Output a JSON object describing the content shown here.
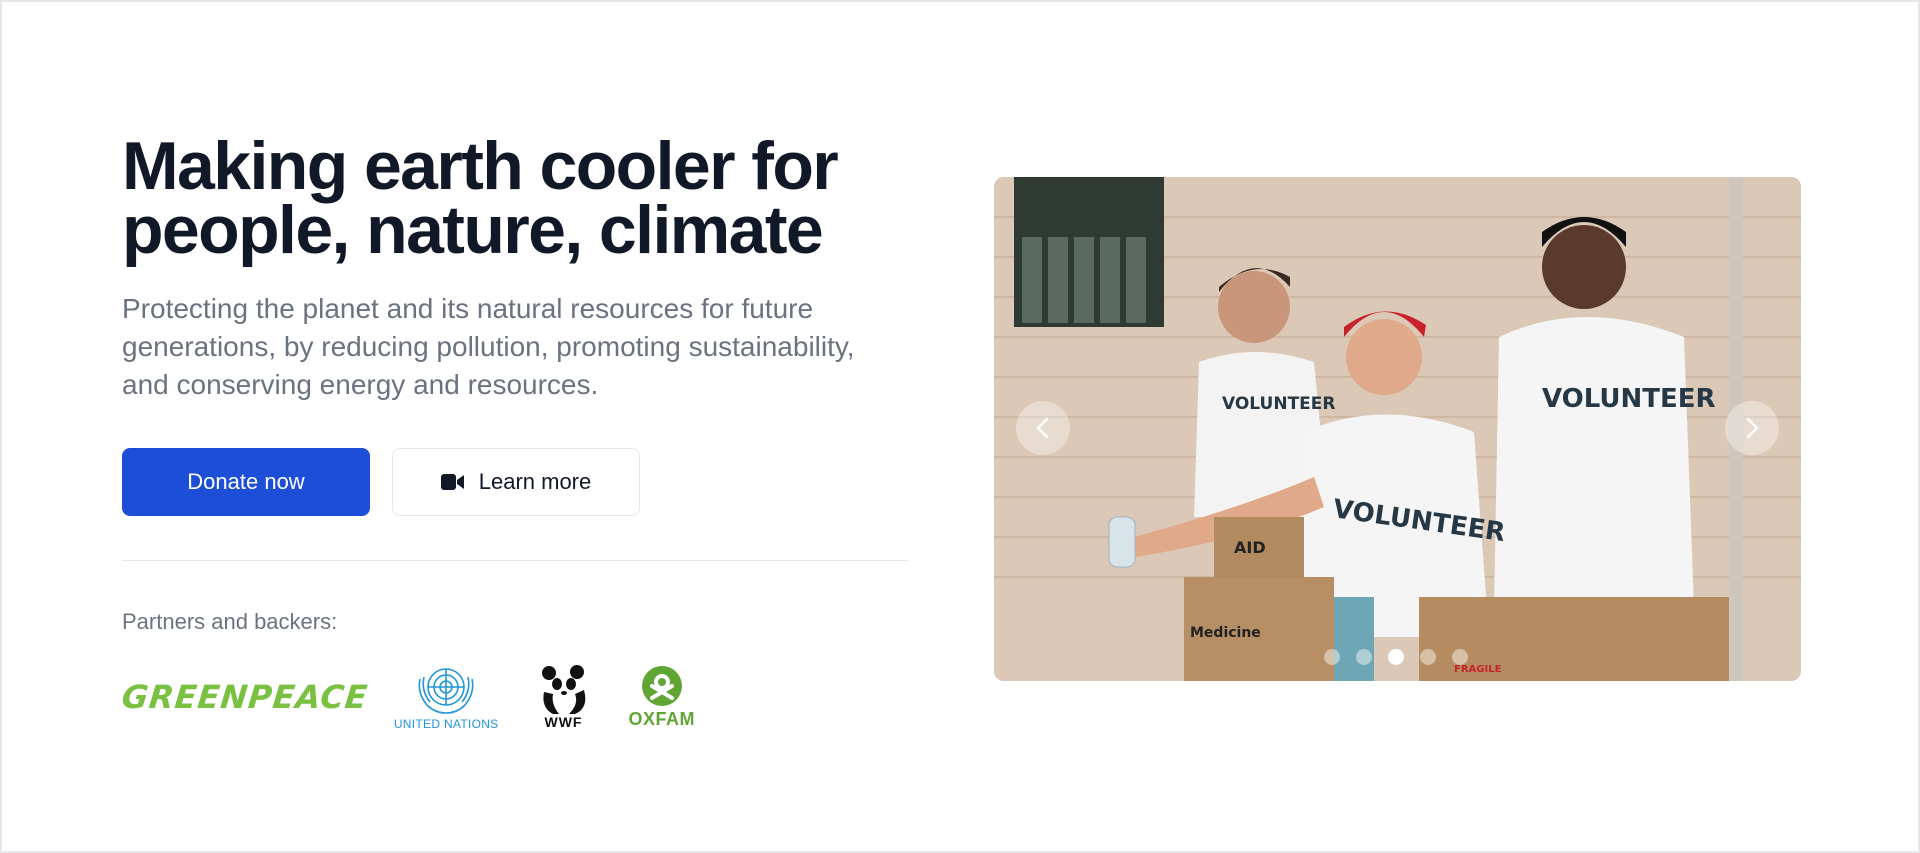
{
  "hero": {
    "headline_line1": "Making earth cooler for",
    "headline_line2": "people, nature, climate",
    "subtitle": "Protecting the planet and its natural resources for future generations, by reducing pollution, promoting sustainability, and conserving energy and resources.",
    "primary_button_label": "Donate now",
    "secondary_button_label": "Learn more",
    "secondary_button_icon": "video-camera-icon",
    "partners_label": "Partners and backers:"
  },
  "partners": {
    "greenpeace": "GREENPEACE",
    "united_nations": "UNITED NATIONS",
    "wwf": "WWF",
    "oxfam": "OXFAM"
  },
  "carousel": {
    "image_texts": {
      "volunteer": "VOLUNTEER",
      "aid": "AID",
      "medicine": "Medicine",
      "fragile": "FRAGILE"
    },
    "slide_count": 5,
    "active_slide": 3,
    "prev_icon": "chevron-left-icon",
    "next_icon": "chevron-right-icon"
  },
  "colors": {
    "primary": "#1d4ed8",
    "headline": "#111827",
    "muted": "#6b7280",
    "greenpeace": "#7ac142",
    "un": "#2196d8",
    "oxfam": "#61a534"
  }
}
